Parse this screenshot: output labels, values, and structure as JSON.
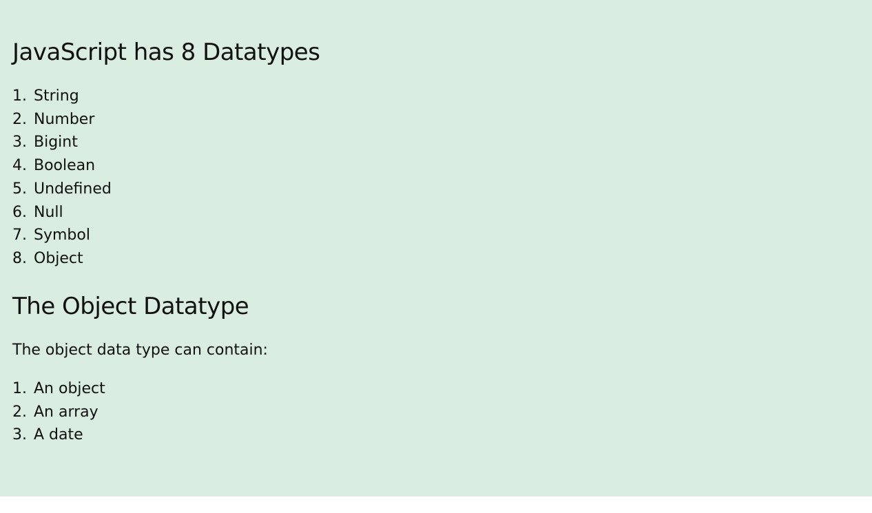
{
  "colors": {
    "page_background": "#d9ede1",
    "text": "#111111"
  },
  "section1": {
    "heading": "JavaScript has 8 Datatypes",
    "items": [
      {
        "num": "1.",
        "label": "String"
      },
      {
        "num": "2.",
        "label": "Number"
      },
      {
        "num": "3.",
        "label": "Bigint"
      },
      {
        "num": "4.",
        "label": "Boolean"
      },
      {
        "num": "5.",
        "label": "Undefined"
      },
      {
        "num": "6.",
        "label": "Null"
      },
      {
        "num": "7.",
        "label": "Symbol"
      },
      {
        "num": "8.",
        "label": "Object"
      }
    ]
  },
  "section2": {
    "heading": "The Object Datatype",
    "paragraph": "The object data type can contain:",
    "items": [
      {
        "num": "1.",
        "label": "An object"
      },
      {
        "num": "2.",
        "label": "An array"
      },
      {
        "num": "3.",
        "label": "A date"
      }
    ]
  }
}
